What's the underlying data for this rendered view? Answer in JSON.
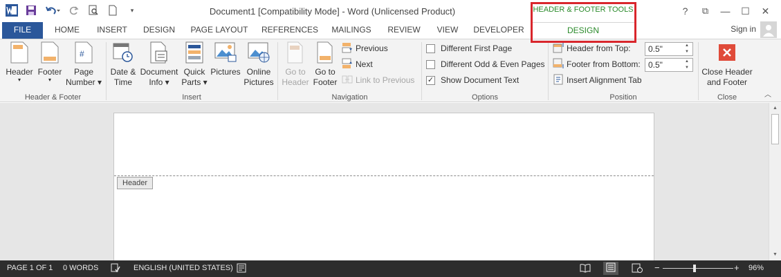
{
  "window": {
    "title": "Document1 [Compatibility Mode] - Word (Unlicensed Product)",
    "help": "?",
    "restore_ribbon": "⧉",
    "minimize": "—",
    "maximize": "☐",
    "close": "✕"
  },
  "contextual": {
    "group_label": "HEADER & FOOTER TOOLS",
    "tab_label": "DESIGN",
    "color": "#2a8a2a",
    "highlight_color": "#d9262c"
  },
  "tabs": {
    "file": "FILE",
    "home": "HOME",
    "insert": "INSERT",
    "design": "DESIGN",
    "page_layout": "PAGE LAYOUT",
    "references": "REFERENCES",
    "mailings": "MAILINGS",
    "review": "REVIEW",
    "view": "VIEW",
    "developer": "DEVELOPER"
  },
  "account": {
    "signin": "Sign in"
  },
  "ribbon": {
    "header_footer": {
      "label": "Header & Footer",
      "header_l1": "Header",
      "footer_l1": "Footer",
      "page_number_l1": "Page",
      "page_number_l2": "Number"
    },
    "insert": {
      "label": "Insert",
      "date_time_l1": "Date &",
      "date_time_l2": "Time",
      "document_info_l1": "Document",
      "document_info_l2": "Info",
      "quick_parts_l1": "Quick",
      "quick_parts_l2": "Parts",
      "pictures": "Pictures",
      "online_pictures_l1": "Online",
      "online_pictures_l2": "Pictures"
    },
    "navigation": {
      "label": "Navigation",
      "go_to_header_l1": "Go to",
      "go_to_header_l2": "Header",
      "go_to_footer_l1": "Go to",
      "go_to_footer_l2": "Footer",
      "previous": "Previous",
      "next": "Next",
      "link_to_previous": "Link to Previous"
    },
    "options": {
      "label": "Options",
      "different_first_page": "Different First Page",
      "different_odd_even": "Different Odd & Even Pages",
      "show_document_text": "Show Document Text",
      "different_first_page_checked": false,
      "different_odd_even_checked": false,
      "show_document_text_checked": true,
      "check_glyph": "✓"
    },
    "position": {
      "label": "Position",
      "header_from_top": "Header from Top:",
      "header_from_top_value": "0.5\"",
      "footer_from_bottom": "Footer from Bottom:",
      "footer_from_bottom_value": "0.5\"",
      "insert_alignment_tab": "Insert Alignment Tab"
    },
    "close": {
      "label": "Close",
      "close_hf_l1": "Close Header",
      "close_hf_l2": "and Footer"
    }
  },
  "document": {
    "header_tag": "Header"
  },
  "statusbar": {
    "page": "PAGE 1 OF 1",
    "words": "0 WORDS",
    "language": "ENGLISH (UNITED STATES)",
    "zoom_minus": "−",
    "zoom_plus": "+",
    "zoom_value": "96%",
    "zoom_level": 0.96
  }
}
